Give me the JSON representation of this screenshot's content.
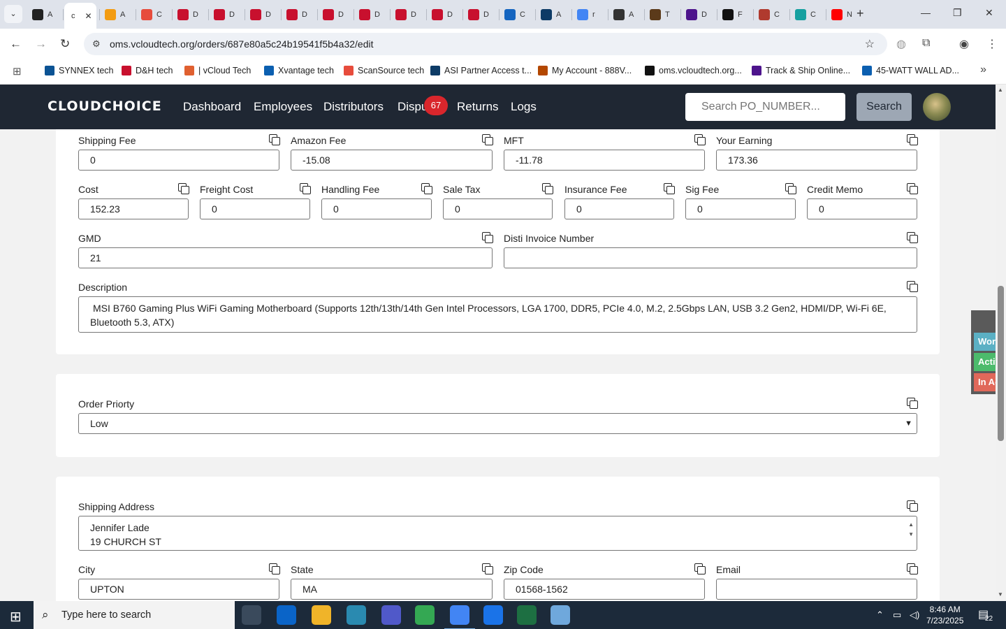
{
  "browser": {
    "tabs": [
      {
        "label": "A",
        "favicon_color": "#222222"
      },
      {
        "label": "c",
        "favicon_color": "#ffffff",
        "active": true
      },
      {
        "label": "A",
        "favicon_color": "#f39c12"
      },
      {
        "label": "C",
        "favicon_color": "#e74c3c"
      },
      {
        "label": "D",
        "favicon_color": "#c8102e"
      },
      {
        "label": "D",
        "favicon_color": "#c8102e"
      },
      {
        "label": "D",
        "favicon_color": "#c8102e"
      },
      {
        "label": "D",
        "favicon_color": "#c8102e"
      },
      {
        "label": "D",
        "favicon_color": "#c8102e"
      },
      {
        "label": "D",
        "favicon_color": "#c8102e"
      },
      {
        "label": "D",
        "favicon_color": "#c8102e"
      },
      {
        "label": "D",
        "favicon_color": "#c8102e"
      },
      {
        "label": "D",
        "favicon_color": "#c8102e"
      },
      {
        "label": "C",
        "favicon_color": "#1565c0"
      },
      {
        "label": "A",
        "favicon_color": "#0d3b66"
      },
      {
        "label": "r",
        "favicon_color": "#4285f4"
      },
      {
        "label": "A",
        "favicon_color": "#333333"
      },
      {
        "label": "T",
        "favicon_color": "#5b3a1a"
      },
      {
        "label": "D",
        "favicon_color": "#4d148c"
      },
      {
        "label": "F",
        "favicon_color": "#111111"
      },
      {
        "label": "C",
        "favicon_color": "#b03a2e"
      },
      {
        "label": "C",
        "favicon_color": "#16a0a0"
      },
      {
        "label": "N",
        "favicon_color": "#ff0000"
      }
    ],
    "url": "oms.vcloudtech.org/orders/687e80a5c24b19541f5b4a32/edit",
    "bookmarks": [
      {
        "label": "SYNNEX tech",
        "color": "#0b5394"
      },
      {
        "label": "D&H tech",
        "color": "#c8102e"
      },
      {
        "label": "| vCloud Tech",
        "color": "#e06030"
      },
      {
        "label": "Xvantage tech",
        "color": "#0b5fb0"
      },
      {
        "label": "ScanSource tech",
        "color": "#e74c3c"
      },
      {
        "label": "ASI Partner Access t...",
        "color": "#0d3b66"
      },
      {
        "label": "My Account - 888V...",
        "color": "#b34700"
      },
      {
        "label": "oms.vcloudtech.org...",
        "color": "#111111"
      },
      {
        "label": "Track & Ship Online...",
        "color": "#4d148c"
      },
      {
        "label": "45-WATT WALL AD...",
        "color": "#0b5fb0"
      }
    ]
  },
  "app": {
    "logo": "CLOUDCHOICE",
    "nav": [
      "Dashboard",
      "Employees",
      "Distributors",
      "Dispu",
      "Returns",
      "Logs"
    ],
    "disputes_badge": "67",
    "search_placeholder": "Search PO_NUMBER...",
    "search_button": "Search"
  },
  "fees": {
    "row1": [
      {
        "label": "Shipping Fee",
        "value": "0"
      },
      {
        "label": "Amazon Fee",
        "value": "-15.08"
      },
      {
        "label": "MFT",
        "value": "-11.78"
      },
      {
        "label": "Your Earning",
        "value": "173.36"
      }
    ],
    "row2": [
      {
        "label": "Cost",
        "value": "152.23"
      },
      {
        "label": "Freight Cost",
        "value": "0"
      },
      {
        "label": "Handling Fee",
        "value": "0"
      },
      {
        "label": "Sale Tax",
        "value": "0"
      },
      {
        "label": "Insurance Fee",
        "value": "0"
      },
      {
        "label": "Sig Fee",
        "value": "0"
      },
      {
        "label": "Credit Memo",
        "value": "0"
      }
    ],
    "gmd": {
      "label": "GMD",
      "value": "21"
    },
    "disti_invoice": {
      "label": "Disti Invoice Number",
      "value": ""
    },
    "description": {
      "label": "Description",
      "value": "MSI B760 Gaming Plus WiFi Gaming Motherboard (Supports 12th/13th/14th Gen Intel Processors, LGA 1700, DDR5, PCIe 4.0, M.2, 2.5Gbps LAN, USB 3.2 Gen2, HDMI/DP, Wi-Fi 6E, Bluetooth 5.3, ATX)"
    }
  },
  "priority": {
    "label": "Order Priorty",
    "value": "Low"
  },
  "shipping": {
    "address_label": "Shipping Address",
    "address_line1": "Jennifer Lade",
    "address_line2": "19 CHURCH ST",
    "city": {
      "label": "City",
      "value": "UPTON"
    },
    "state": {
      "label": "State",
      "value": "MA"
    },
    "zip": {
      "label": "Zip Code",
      "value": "01568-1562"
    },
    "email": {
      "label": "Email",
      "value": ""
    }
  },
  "side_panel": [
    {
      "label": "Working",
      "color": "#5bb0c4"
    },
    {
      "label": "Active",
      "color": "#4cbb6c"
    },
    {
      "label": "In Active",
      "color": "#e0685a"
    }
  ],
  "taskbar": {
    "search_placeholder": "Type here to search",
    "time": "8:46 AM",
    "date": "7/23/2025",
    "notification_count": "22",
    "apps": [
      {
        "name": "task-view",
        "color": "#3a4a5c"
      },
      {
        "name": "outlook",
        "color": "#0a64c8"
      },
      {
        "name": "file-explorer",
        "color": "#f0b429"
      },
      {
        "name": "app-diamond",
        "color": "#2a8ab0"
      },
      {
        "name": "teams",
        "color": "#5059c9"
      },
      {
        "name": "chrome",
        "color": "#34a853"
      },
      {
        "name": "chrome-profile",
        "color": "#4285f4"
      },
      {
        "name": "zoho",
        "color": "#1a73e8"
      },
      {
        "name": "excel",
        "color": "#1d6f42"
      },
      {
        "name": "notepad",
        "color": "#6fa8dc"
      }
    ]
  }
}
